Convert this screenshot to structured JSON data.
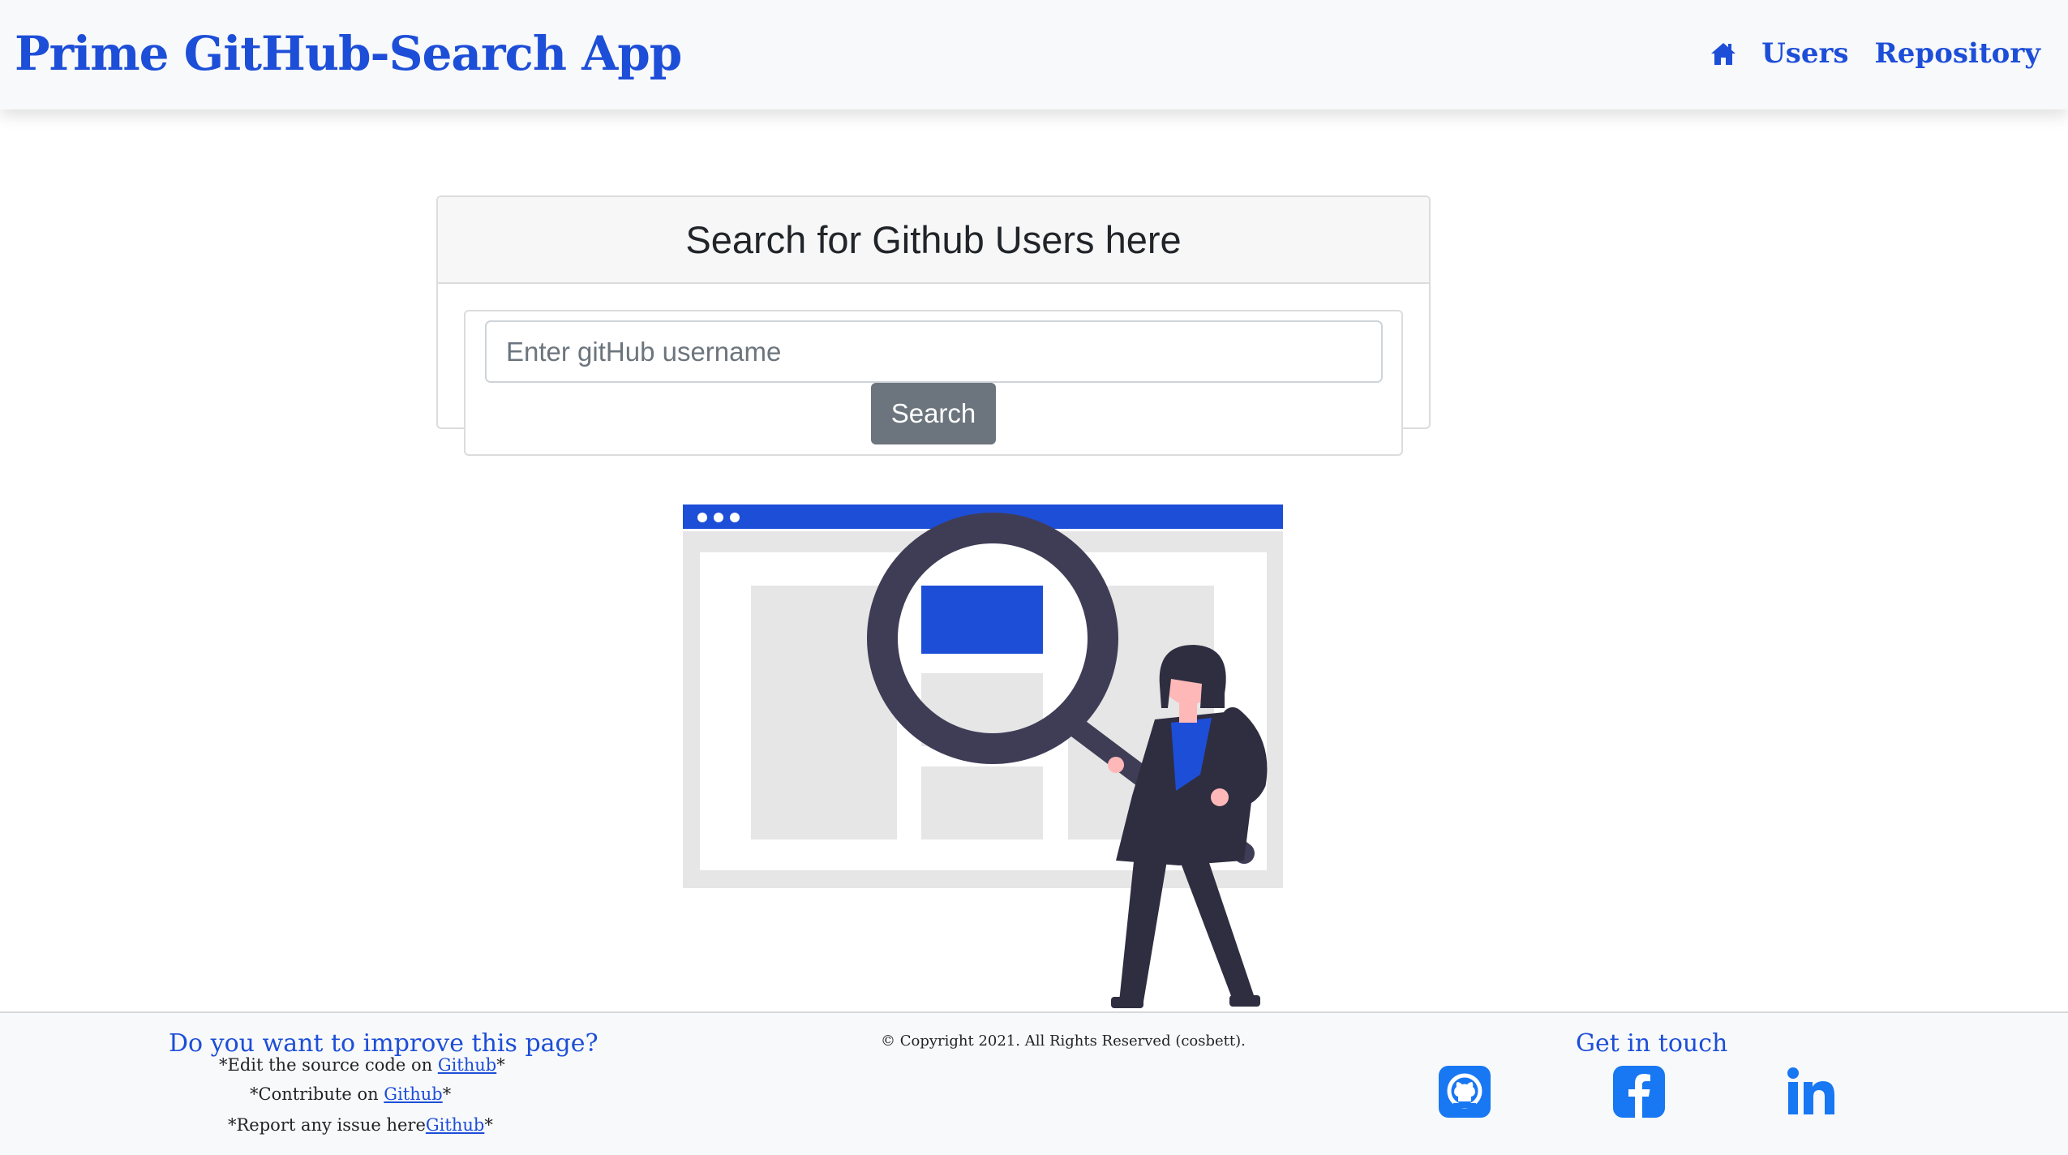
{
  "navbar": {
    "brand": "Prime GitHub-Search App",
    "home_icon": "home-icon",
    "links": [
      "Users",
      "Repository"
    ]
  },
  "search_card": {
    "title": "Search for Github Users here",
    "input_placeholder": "Enter gitHub username",
    "input_value": "",
    "button_label": "Search"
  },
  "illustration": {
    "name": "woman-with-magnifying-glass-illustration"
  },
  "footer": {
    "improve_title": "Do you want to improve this page?",
    "lines": [
      {
        "prefix": "*Edit the source code on ",
        "link": "Github",
        "suffix": "*"
      },
      {
        "prefix": "*Contribute on ",
        "link": "Github",
        "suffix": "*"
      },
      {
        "prefix": "*Report any issue here",
        "link": "Github",
        "suffix": "*"
      }
    ],
    "copyright": "© Copyright 2021. All Rights Reserved (cosbett).",
    "touch_title": "Get in touch",
    "social_icons": [
      "github-icon",
      "facebook-icon",
      "linkedin-icon"
    ]
  },
  "colors": {
    "accent": "#1d4ed8",
    "button_gray": "#6c757d",
    "navbar_bg": "#f8f9fa",
    "figure_dark": "#2f2e41"
  }
}
